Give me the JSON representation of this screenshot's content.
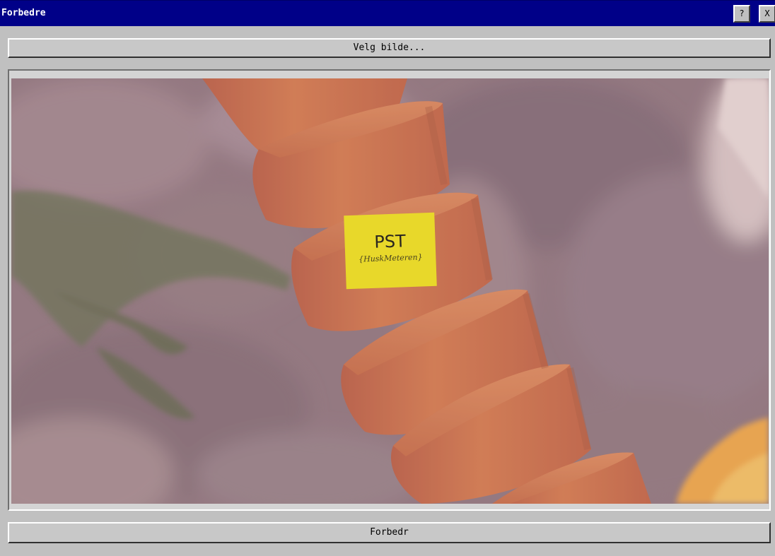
{
  "window": {
    "title": "Forbedre",
    "help_label": "?",
    "close_label": "X"
  },
  "toolbar": {
    "choose_image_label": "Velg bilde..."
  },
  "preview": {
    "note_text": "PST",
    "note_subtext": "{HuskMeteren}",
    "accent_pot_color": "#d06a38",
    "note_color": "#e8d82a"
  },
  "actions": {
    "improve_label": "Forbedr"
  }
}
